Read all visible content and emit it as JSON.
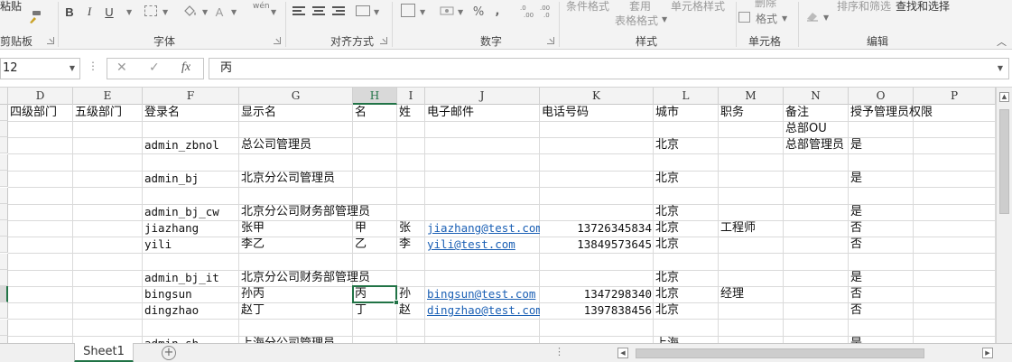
{
  "ribbon": {
    "clipboard": {
      "paste_label": "粘贴",
      "group_label": "剪贴板"
    },
    "font": {
      "group_label": "字体",
      "bold": "B",
      "italic": "I",
      "underline": "U",
      "font_color_glyph": "A",
      "phonetic_glyph": "wén"
    },
    "alignment": {
      "group_label": "对齐方式"
    },
    "number": {
      "group_label": "数字",
      "percent": "%",
      "comma": ","
    },
    "styles": {
      "group_label": "样式",
      "conditional_format": "条件格式",
      "apply_table_line1": "套用",
      "apply_table_line2": "表格格式",
      "cell_styles": "单元格样式"
    },
    "cells": {
      "group_label": "单元格",
      "delete": "删除",
      "format": "格式"
    },
    "editing": {
      "group_label": "编辑",
      "sort_filter": "排序和筛选",
      "find_select": "查找和选择"
    }
  },
  "formula_bar": {
    "name_box": "12",
    "cancel_glyph": "✕",
    "confirm_glyph": "✓",
    "fx_glyph": "fx",
    "value": "丙"
  },
  "columns": [
    "D",
    "E",
    "F",
    "G",
    "H",
    "I",
    "J",
    "K",
    "L",
    "M",
    "N",
    "O",
    "P"
  ],
  "rows": [
    {
      "D": "四级部门",
      "E": "五级部门",
      "F": "登录名",
      "G": "显示名",
      "H": "名",
      "I": "姓",
      "J": "电子邮件",
      "K": "电话号码",
      "L": "城市",
      "M": "职务",
      "N": "备注",
      "O": "授予管理员权限"
    },
    {
      "N": "总部OU"
    },
    {
      "F": "admin_zbnol",
      "G": "总公司管理员",
      "L": "北京",
      "N": "总部管理员",
      "O": "是"
    },
    {},
    {
      "F": "admin_bj",
      "G": "北京分公司管理员",
      "L": "北京",
      "O": "是"
    },
    {},
    {
      "F": "admin_bj_cw",
      "G": "北京分公司财务部管理员",
      "L": "北京",
      "O": "是"
    },
    {
      "F": "jiazhang",
      "G": "张甲",
      "H": "甲",
      "I": "张",
      "J": "jiazhang@test.com",
      "K": "13726345834",
      "L": "北京",
      "M": "工程师",
      "O": "否"
    },
    {
      "F": "yili",
      "G": "李乙",
      "H": "乙",
      "I": "李",
      "J": "yili@test.com",
      "K": "13849573645",
      "L": "北京",
      "O": "否"
    },
    {},
    {
      "F": "admin_bj_it",
      "G": "北京分公司财务部管理员",
      "L": "北京",
      "O": "是"
    },
    {
      "F": "bingsun",
      "G": "孙丙",
      "H": "丙",
      "I": "孙",
      "J": "bingsun@test.com",
      "K": "1347298340",
      "L": "北京",
      "M": "经理",
      "O": "否"
    },
    {
      "F": "dingzhao",
      "G": "赵丁",
      "H": "丁",
      "I": "赵",
      "J": "dingzhao@test.com",
      "K": "1397838456",
      "L": "北京",
      "O": "否"
    },
    {},
    {
      "F": "admin_sh",
      "G": "上海分公司管理员",
      "L": "上海",
      "O": "是"
    }
  ],
  "selected_cell": {
    "column": "H",
    "row_index": 11
  },
  "sheet_tabs": [
    {
      "label": "Sheet1",
      "active": true
    }
  ],
  "add_sheet_glyph": "+",
  "accent_color": "#217346",
  "link_color": "#1a5fb4"
}
